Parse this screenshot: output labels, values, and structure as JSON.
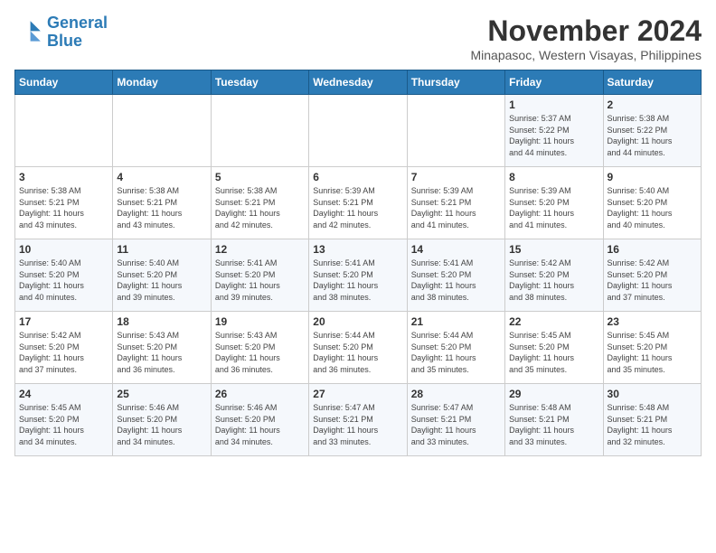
{
  "header": {
    "logo_line1": "General",
    "logo_line2": "Blue",
    "month": "November 2024",
    "location": "Minapasoc, Western Visayas, Philippines"
  },
  "days_of_week": [
    "Sunday",
    "Monday",
    "Tuesday",
    "Wednesday",
    "Thursday",
    "Friday",
    "Saturday"
  ],
  "weeks": [
    [
      {
        "day": "",
        "info": ""
      },
      {
        "day": "",
        "info": ""
      },
      {
        "day": "",
        "info": ""
      },
      {
        "day": "",
        "info": ""
      },
      {
        "day": "",
        "info": ""
      },
      {
        "day": "1",
        "info": "Sunrise: 5:37 AM\nSunset: 5:22 PM\nDaylight: 11 hours\nand 44 minutes."
      },
      {
        "day": "2",
        "info": "Sunrise: 5:38 AM\nSunset: 5:22 PM\nDaylight: 11 hours\nand 44 minutes."
      }
    ],
    [
      {
        "day": "3",
        "info": "Sunrise: 5:38 AM\nSunset: 5:21 PM\nDaylight: 11 hours\nand 43 minutes."
      },
      {
        "day": "4",
        "info": "Sunrise: 5:38 AM\nSunset: 5:21 PM\nDaylight: 11 hours\nand 43 minutes."
      },
      {
        "day": "5",
        "info": "Sunrise: 5:38 AM\nSunset: 5:21 PM\nDaylight: 11 hours\nand 42 minutes."
      },
      {
        "day": "6",
        "info": "Sunrise: 5:39 AM\nSunset: 5:21 PM\nDaylight: 11 hours\nand 42 minutes."
      },
      {
        "day": "7",
        "info": "Sunrise: 5:39 AM\nSunset: 5:21 PM\nDaylight: 11 hours\nand 41 minutes."
      },
      {
        "day": "8",
        "info": "Sunrise: 5:39 AM\nSunset: 5:20 PM\nDaylight: 11 hours\nand 41 minutes."
      },
      {
        "day": "9",
        "info": "Sunrise: 5:40 AM\nSunset: 5:20 PM\nDaylight: 11 hours\nand 40 minutes."
      }
    ],
    [
      {
        "day": "10",
        "info": "Sunrise: 5:40 AM\nSunset: 5:20 PM\nDaylight: 11 hours\nand 40 minutes."
      },
      {
        "day": "11",
        "info": "Sunrise: 5:40 AM\nSunset: 5:20 PM\nDaylight: 11 hours\nand 39 minutes."
      },
      {
        "day": "12",
        "info": "Sunrise: 5:41 AM\nSunset: 5:20 PM\nDaylight: 11 hours\nand 39 minutes."
      },
      {
        "day": "13",
        "info": "Sunrise: 5:41 AM\nSunset: 5:20 PM\nDaylight: 11 hours\nand 38 minutes."
      },
      {
        "day": "14",
        "info": "Sunrise: 5:41 AM\nSunset: 5:20 PM\nDaylight: 11 hours\nand 38 minutes."
      },
      {
        "day": "15",
        "info": "Sunrise: 5:42 AM\nSunset: 5:20 PM\nDaylight: 11 hours\nand 38 minutes."
      },
      {
        "day": "16",
        "info": "Sunrise: 5:42 AM\nSunset: 5:20 PM\nDaylight: 11 hours\nand 37 minutes."
      }
    ],
    [
      {
        "day": "17",
        "info": "Sunrise: 5:42 AM\nSunset: 5:20 PM\nDaylight: 11 hours\nand 37 minutes."
      },
      {
        "day": "18",
        "info": "Sunrise: 5:43 AM\nSunset: 5:20 PM\nDaylight: 11 hours\nand 36 minutes."
      },
      {
        "day": "19",
        "info": "Sunrise: 5:43 AM\nSunset: 5:20 PM\nDaylight: 11 hours\nand 36 minutes."
      },
      {
        "day": "20",
        "info": "Sunrise: 5:44 AM\nSunset: 5:20 PM\nDaylight: 11 hours\nand 36 minutes."
      },
      {
        "day": "21",
        "info": "Sunrise: 5:44 AM\nSunset: 5:20 PM\nDaylight: 11 hours\nand 35 minutes."
      },
      {
        "day": "22",
        "info": "Sunrise: 5:45 AM\nSunset: 5:20 PM\nDaylight: 11 hours\nand 35 minutes."
      },
      {
        "day": "23",
        "info": "Sunrise: 5:45 AM\nSunset: 5:20 PM\nDaylight: 11 hours\nand 35 minutes."
      }
    ],
    [
      {
        "day": "24",
        "info": "Sunrise: 5:45 AM\nSunset: 5:20 PM\nDaylight: 11 hours\nand 34 minutes."
      },
      {
        "day": "25",
        "info": "Sunrise: 5:46 AM\nSunset: 5:20 PM\nDaylight: 11 hours\nand 34 minutes."
      },
      {
        "day": "26",
        "info": "Sunrise: 5:46 AM\nSunset: 5:20 PM\nDaylight: 11 hours\nand 34 minutes."
      },
      {
        "day": "27",
        "info": "Sunrise: 5:47 AM\nSunset: 5:21 PM\nDaylight: 11 hours\nand 33 minutes."
      },
      {
        "day": "28",
        "info": "Sunrise: 5:47 AM\nSunset: 5:21 PM\nDaylight: 11 hours\nand 33 minutes."
      },
      {
        "day": "29",
        "info": "Sunrise: 5:48 AM\nSunset: 5:21 PM\nDaylight: 11 hours\nand 33 minutes."
      },
      {
        "day": "30",
        "info": "Sunrise: 5:48 AM\nSunset: 5:21 PM\nDaylight: 11 hours\nand 32 minutes."
      }
    ]
  ]
}
